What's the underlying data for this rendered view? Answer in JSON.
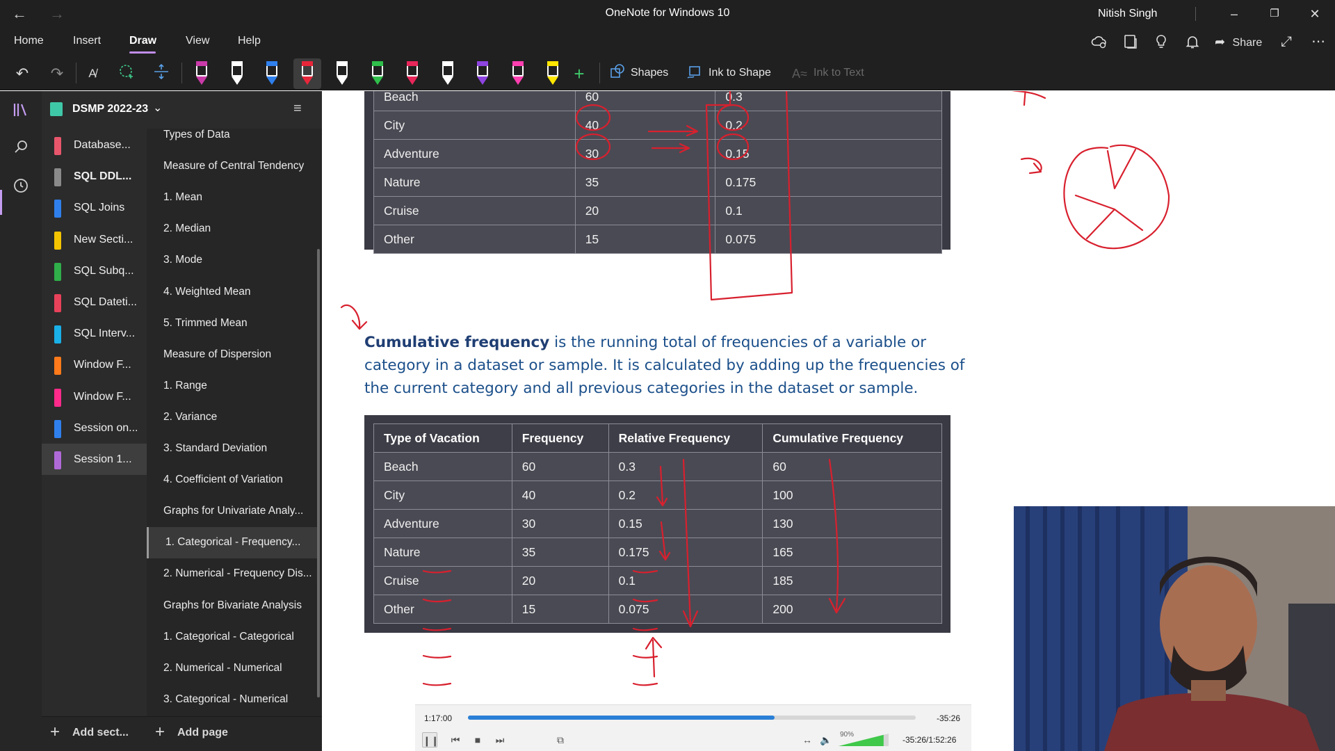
{
  "titlebar": {
    "app_title": "OneNote for Windows 10",
    "user_name": "Nitish Singh"
  },
  "menu": {
    "tabs": [
      "Home",
      "Insert",
      "Draw",
      "View",
      "Help"
    ],
    "active_tab": "Draw",
    "share_label": "Share"
  },
  "toolbar": {
    "shapes_label": "Shapes",
    "ink_to_shape_label": "Ink to Shape",
    "ink_to_text_label": "Ink to Text",
    "pen_colors": [
      "#c93aa8",
      "#ffffff",
      "#2f80ed",
      "#e8263a",
      "#ffffff",
      "#2fbf4a",
      "#e8265a",
      "#ffffff",
      "#8e44e0",
      "#ff3fb0",
      "#ffe600"
    ]
  },
  "notebook": {
    "name": "DSMP 2022-23",
    "add_section_label": "Add sect...",
    "add_page_label": "Add page"
  },
  "sections": [
    {
      "label": "Database...",
      "color": "#e8566c"
    },
    {
      "label": "SQL DDL...",
      "color": "#8a8a8a",
      "bold": true
    },
    {
      "label": "SQL Joins",
      "color": "#2f80ed"
    },
    {
      "label": "New Secti...",
      "color": "#f5c400"
    },
    {
      "label": "SQL Subq...",
      "color": "#2fae4a"
    },
    {
      "label": "SQL Dateti...",
      "color": "#e8415a"
    },
    {
      "label": "SQL Interv...",
      "color": "#1ab0e8"
    },
    {
      "label": "Window F...",
      "color": "#ff7a1a"
    },
    {
      "label": "Window F...",
      "color": "#ff2a8a"
    },
    {
      "label": "Session on...",
      "color": "#2f80ed"
    },
    {
      "label": "Session 1...",
      "color": "#b06ad8",
      "selected": true
    }
  ],
  "pages": [
    "Types of Data",
    "Measure of Central Tendency",
    "1. Mean",
    "2. Median",
    "3. Mode",
    "4. Weighted Mean",
    "5. Trimmed Mean",
    "Measure of Dispersion",
    "1. Range",
    "2. Variance",
    "3. Standard Deviation",
    "4. Coefficient of Variation",
    "Graphs for Univariate Analy...",
    "1. Categorical - Frequency...",
    "2. Numerical - Frequency Dis...",
    "Graphs for Bivariate Analysis",
    "1. Categorical - Categorical",
    "2. Numerical - Numerical",
    "3. Categorical - Numerical"
  ],
  "selected_page_index": 13,
  "content": {
    "top_table": {
      "rows": [
        [
          "Beach",
          "60",
          "0.3"
        ],
        [
          "City",
          "40",
          "0.2"
        ],
        [
          "Adventure",
          "30",
          "0.15"
        ],
        [
          "Nature",
          "35",
          "0.175"
        ],
        [
          "Cruise",
          "20",
          "0.1"
        ],
        [
          "Other",
          "15",
          "0.075"
        ]
      ]
    },
    "paragraph": {
      "term": "Cumulative frequency",
      "text": " is the running total of frequencies of a variable or category in a dataset or sample. It is calculated by adding up the frequencies of the current category and all previous categories in the dataset or sample."
    },
    "cumulative_table": {
      "headers": [
        "Type of Vacation",
        "Frequency",
        "Relative Frequency",
        "Cumulative Frequency"
      ],
      "rows": [
        [
          "Beach",
          "60",
          "0.3",
          "60"
        ],
        [
          "City",
          "40",
          "0.2",
          "100"
        ],
        [
          "Adventure",
          "30",
          "0.15",
          "130"
        ],
        [
          "Nature",
          "35",
          "0.175",
          "165"
        ],
        [
          "Cruise",
          "20",
          "0.1",
          "185"
        ],
        [
          "Other",
          "15",
          "0.075",
          "200"
        ]
      ]
    }
  },
  "player": {
    "elapsed": "1:17:00",
    "remaining": "-35:26",
    "remaining_total": "-35:26/1:52:26",
    "progress": 0.685,
    "volume_label": "90%",
    "volume": 0.9
  },
  "colors": {
    "ink": "#d8202e",
    "accent": "#c49cf0"
  }
}
